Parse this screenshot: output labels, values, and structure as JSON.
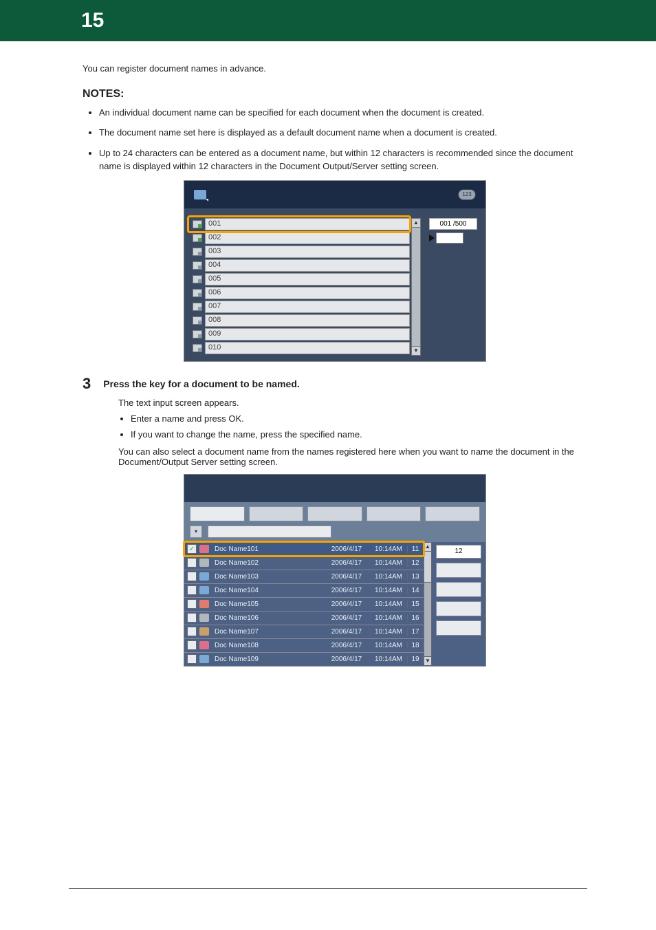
{
  "page_number": "15",
  "intro_para": "You can register document names in advance.",
  "notes_heading": "NOTES:",
  "notes": [
    "An individual document name can be specified for each document when the document is created.",
    "The document name set here is displayed as a default document name when a document is created.",
    "Up to 24 characters can be entered as a document name, but within 12 characters is recommended since the document name is displayed within 12 characters in the Document Output/Server setting screen."
  ],
  "screen1": {
    "rows": [
      "001",
      "002",
      "003",
      "004",
      "005",
      "006",
      "007",
      "008",
      "009",
      "010"
    ],
    "counter": "001",
    "total": "500"
  },
  "step": {
    "num": "3",
    "text": "Press the key for a document to be named."
  },
  "subheading": "The text input screen appears.",
  "substeps": [
    "Enter a name and press OK.",
    "If you want to change the name, press the specified name."
  ],
  "closing": "You can also select a document name from the names registered here when you want to name the document in the Document/Output Server setting screen.",
  "screen2": {
    "count_label": "12",
    "rows": [
      {
        "chk": true,
        "ico": "a",
        "name": "Doc Name101",
        "date": "2006/4/17",
        "time": "10:14AM",
        "pg": "11"
      },
      {
        "chk": false,
        "ico": "d",
        "name": "Doc Name102",
        "date": "2006/4/17",
        "time": "10:14AM",
        "pg": "12"
      },
      {
        "chk": false,
        "ico": "b",
        "name": "Doc Name103",
        "date": "2006/4/17",
        "time": "10:14AM",
        "pg": "13"
      },
      {
        "chk": false,
        "ico": "b",
        "name": "Doc Name104",
        "date": "2006/4/17",
        "time": "10:14AM",
        "pg": "14"
      },
      {
        "chk": false,
        "ico": "c",
        "name": "Doc Name105",
        "date": "2006/4/17",
        "time": "10:14AM",
        "pg": "15"
      },
      {
        "chk": false,
        "ico": "d",
        "name": "Doc Name106",
        "date": "2006/4/17",
        "time": "10:14AM",
        "pg": "16"
      },
      {
        "chk": false,
        "ico": "e",
        "name": "Doc Name107",
        "date": "2006/4/17",
        "time": "10:14AM",
        "pg": "17"
      },
      {
        "chk": false,
        "ico": "a",
        "name": "Doc Name108",
        "date": "2006/4/17",
        "time": "10:14AM",
        "pg": "18"
      },
      {
        "chk": false,
        "ico": "b",
        "name": "Doc Name109",
        "date": "2006/4/17",
        "time": "10:14AM",
        "pg": "19"
      }
    ]
  }
}
